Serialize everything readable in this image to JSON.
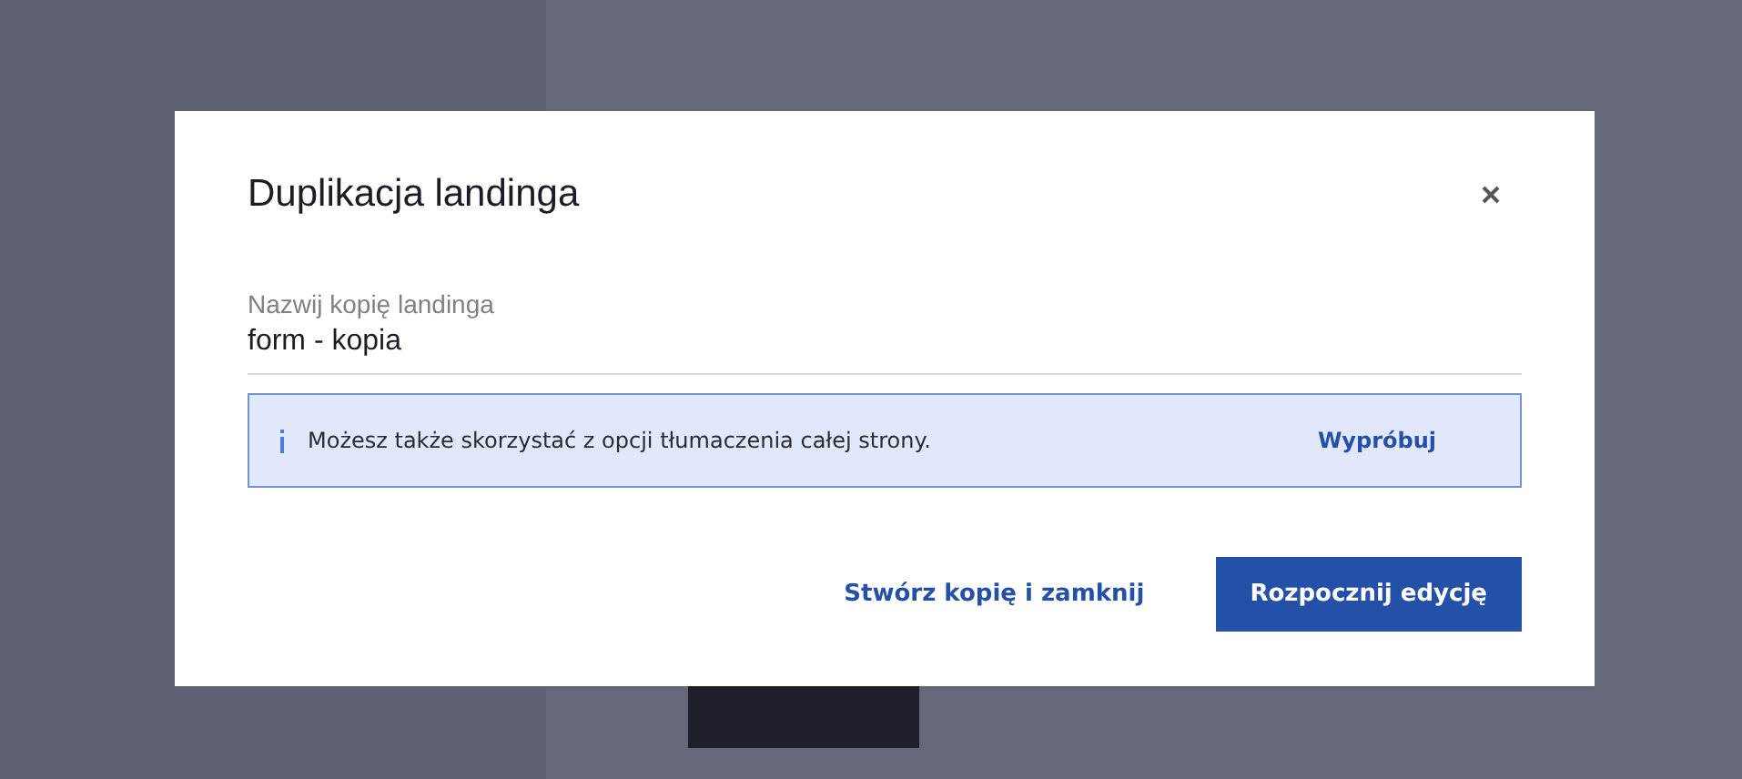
{
  "dialog": {
    "title": "Duplikacja landinga",
    "field": {
      "label": "Nazwij kopię landinga",
      "value": "form - kopia"
    },
    "info": {
      "message": "Możesz także skorzystać z opcji tłumaczenia całej strony.",
      "action": "Wypróbuj"
    },
    "buttons": [
      {
        "label": "Stwórz kopię i zamknij",
        "kind": "link"
      },
      {
        "label": "Rozpocznij edycję",
        "kind": "primary"
      }
    ]
  }
}
